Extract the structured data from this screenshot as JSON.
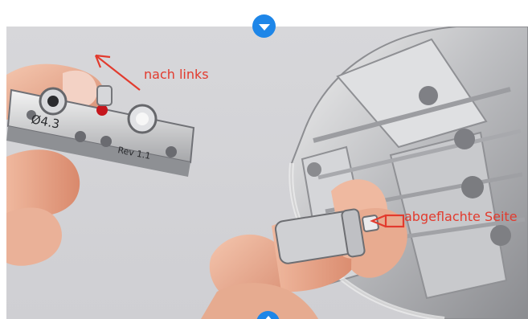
{
  "annotations": {
    "left_label": "nach links",
    "right_label": "abgeflachte Seite"
  },
  "fixture_labels": {
    "diameter": "Ø4.3",
    "revision": "Rev 1.1"
  },
  "controls": {
    "top_icon": "chevron-down-icon",
    "bottom_icon": "chevron-up-icon"
  },
  "colors": {
    "annotation": "#e23b2e",
    "control_accent": "#1e86e8"
  }
}
